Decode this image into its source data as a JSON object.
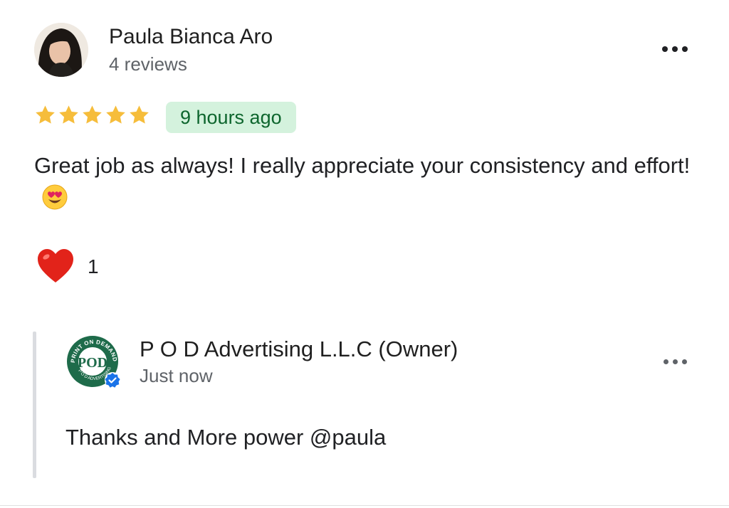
{
  "review": {
    "reviewer_name": "Paula Bianca Aro",
    "reviewer_review_count": "4 reviews",
    "rating": 5,
    "rating_max": 5,
    "time_ago": "9 hours ago",
    "text": "Great job as always! I really appreciate your consistency and effort!",
    "text_emoji": "smiling-face-with-heart-eyes",
    "reactions": {
      "icon": "heart-icon",
      "count": "1"
    }
  },
  "owner_reply": {
    "name": "P O D Advertising L.L.C (Owner)",
    "time": "Just now",
    "text": "Thanks and More power @paula",
    "logo_text": "PRINT ON DEMAND · P O D ADVERTISING",
    "verified": true
  },
  "colors": {
    "star": "#f6bd3b",
    "badge_bg": "#d4f2dd",
    "badge_text": "#0d652d",
    "heart": "#e2231a",
    "logo_green": "#1e6b4a",
    "verified_blue": "#1a73e8",
    "secondary_text": "#5f6368"
  }
}
